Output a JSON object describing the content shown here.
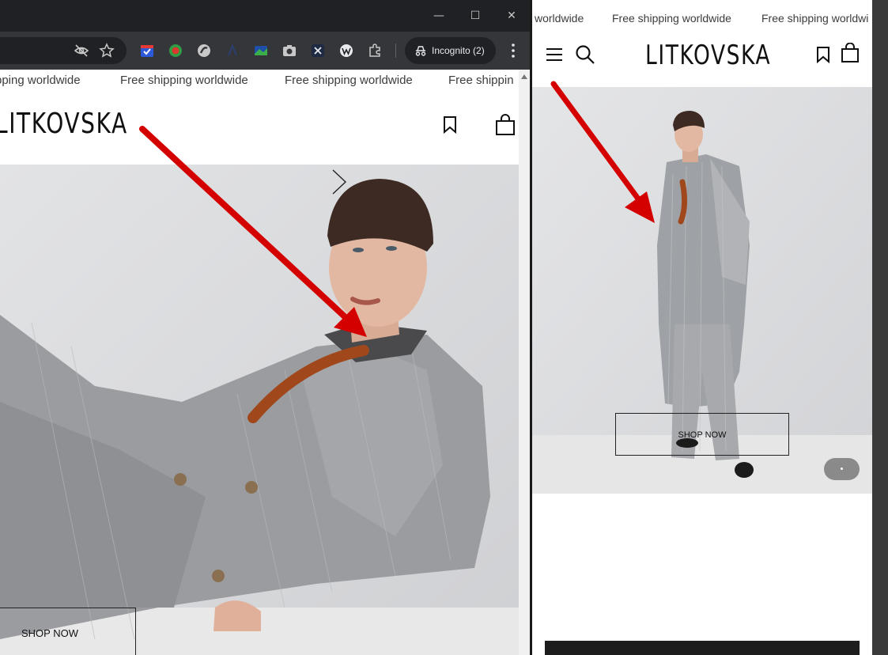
{
  "left_window": {
    "incognito_label": "Incognito (2)",
    "marquee": [
      "pping worldwide",
      "Free shipping worldwide",
      "Free shipping worldwide",
      "Free shippin"
    ],
    "logo": "LITKOVSKA",
    "shop_now": "SHOP NOW"
  },
  "right_view": {
    "marquee": [
      "worldwide",
      "Free shipping worldwide",
      "Free shipping worldwi"
    ],
    "logo": "LITKOVSKA",
    "shop_now": "SHOP NOW"
  },
  "colors": {
    "annotation_arrow": "#d40000",
    "chrome_dark": "#202124",
    "toolbar": "#35363a"
  }
}
